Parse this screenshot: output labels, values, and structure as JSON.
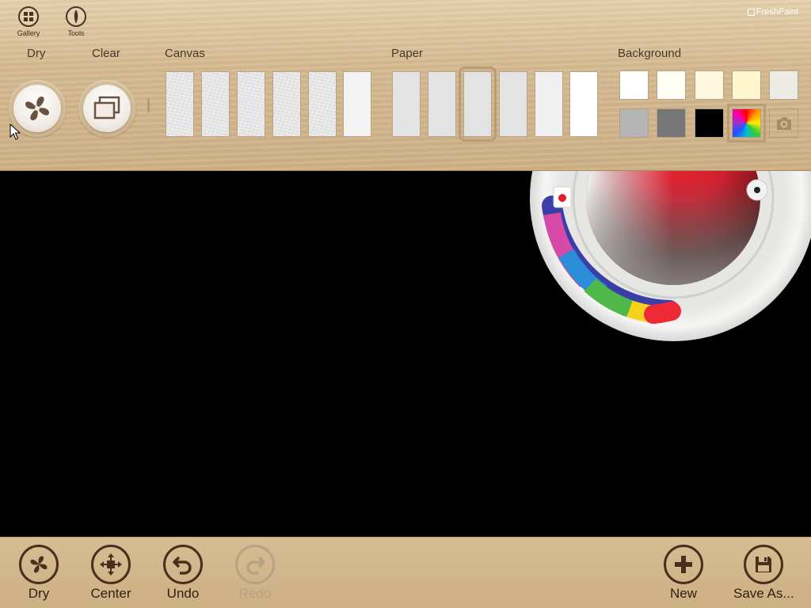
{
  "app": {
    "brand": "FreshPaint"
  },
  "top_nav": [
    {
      "id": "gallery",
      "label": "Gallery",
      "icon": "gallery-icon"
    },
    {
      "id": "tools",
      "label": "Tools",
      "icon": "brush-icon"
    }
  ],
  "actions": {
    "dry": "Dry",
    "clear": "Clear"
  },
  "sections": {
    "canvas": "Canvas",
    "paper": "Paper",
    "background": "Background"
  },
  "canvas_textures": {
    "count": 6,
    "selected": -1
  },
  "paper_textures": {
    "count": 6,
    "selected": 2
  },
  "background_colors": [
    [
      "#ffffff",
      "#fffdf4",
      "#fff8e1",
      "#fff7cc",
      "#ecebe5"
    ],
    [
      "#b4b4b4",
      "#777777",
      "#000000",
      "rainbow",
      "camera"
    ]
  ],
  "background_selected": "rainbow",
  "color_picker": {
    "current_color": "#e41e2b",
    "icon": "color-wheel"
  },
  "bottom_bar": {
    "left": [
      {
        "id": "dry",
        "label": "Dry",
        "icon": "fan-icon",
        "enabled": true
      },
      {
        "id": "center",
        "label": "Center",
        "icon": "center-icon",
        "enabled": true
      },
      {
        "id": "undo",
        "label": "Undo",
        "icon": "undo-icon",
        "enabled": true
      },
      {
        "id": "redo",
        "label": "Redo",
        "icon": "redo-icon",
        "enabled": false
      }
    ],
    "right": [
      {
        "id": "new",
        "label": "New",
        "icon": "plus-icon",
        "enabled": true
      },
      {
        "id": "save_as",
        "label": "Save As...",
        "icon": "floppy-disk-icon",
        "enabled": true
      }
    ]
  },
  "colors": {
    "wood": "#d6bb91",
    "icon_brown": "#4a2f1c",
    "disabled": "#b8a283",
    "canvas": "#000000"
  }
}
